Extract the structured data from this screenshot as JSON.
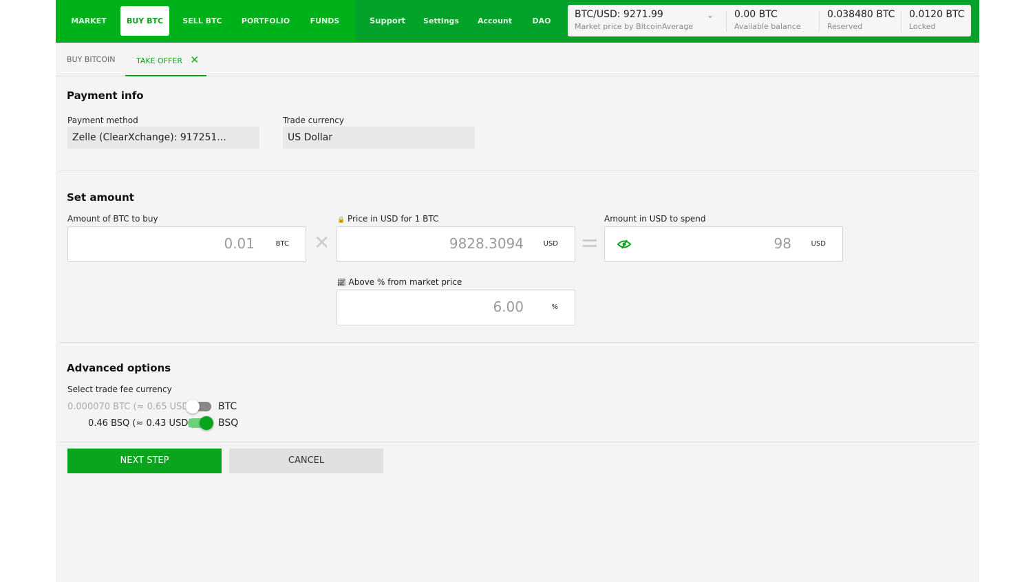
{
  "nav": {
    "items": [
      "MARKET",
      "BUY BTC",
      "SELL BTC",
      "PORTFOLIO",
      "FUNDS"
    ],
    "secondary": [
      "Support",
      "Settings",
      "Account",
      "DAO"
    ],
    "active": "BUY BTC"
  },
  "balance": {
    "price": "BTC/USD: 9271.99",
    "price_label": "Market price by BitcoinAverage",
    "available": "0.00 BTC",
    "available_label": "Available balance",
    "reserved": "0.038480 BTC",
    "reserved_label": "Reserved",
    "locked": "0.0120 BTC",
    "locked_label": "Locked"
  },
  "subtabs": {
    "buy": "BUY BITCOIN",
    "take": "TAKE OFFER"
  },
  "payment": {
    "title": "Payment info",
    "method_label": "Payment method",
    "method": "Zelle (ClearXchange): 917251...",
    "currency_label": "Trade currency",
    "currency": "US Dollar"
  },
  "amount": {
    "title": "Set amount",
    "btc_label": "Amount of BTC to buy",
    "btc_value": "0.01",
    "btc_unit": "BTC",
    "price_label": "Price in USD for 1 BTC",
    "price_value": "9828.3094",
    "price_unit": "USD",
    "spend_label": "Amount in USD to spend",
    "spend_value": "98",
    "spend_unit": "USD",
    "pct_label": "Above % from market price",
    "pct_value": "6.00",
    "pct_unit": "%"
  },
  "advanced": {
    "title": "Advanced options",
    "fee_label": "Select trade fee currency",
    "btc_fee": "0.000070 BTC (≈ 0.65 USD)",
    "btc_name": "BTC",
    "btc_on": false,
    "bsq_fee": "0.46 BSQ (≈ 0.43 USD)",
    "bsq_name": "BSQ",
    "bsq_on": true
  },
  "buttons": {
    "next": "NEXT STEP",
    "cancel": "CANCEL"
  },
  "colors": {
    "brand": "#00b21a",
    "accent": "#0aa51c"
  }
}
